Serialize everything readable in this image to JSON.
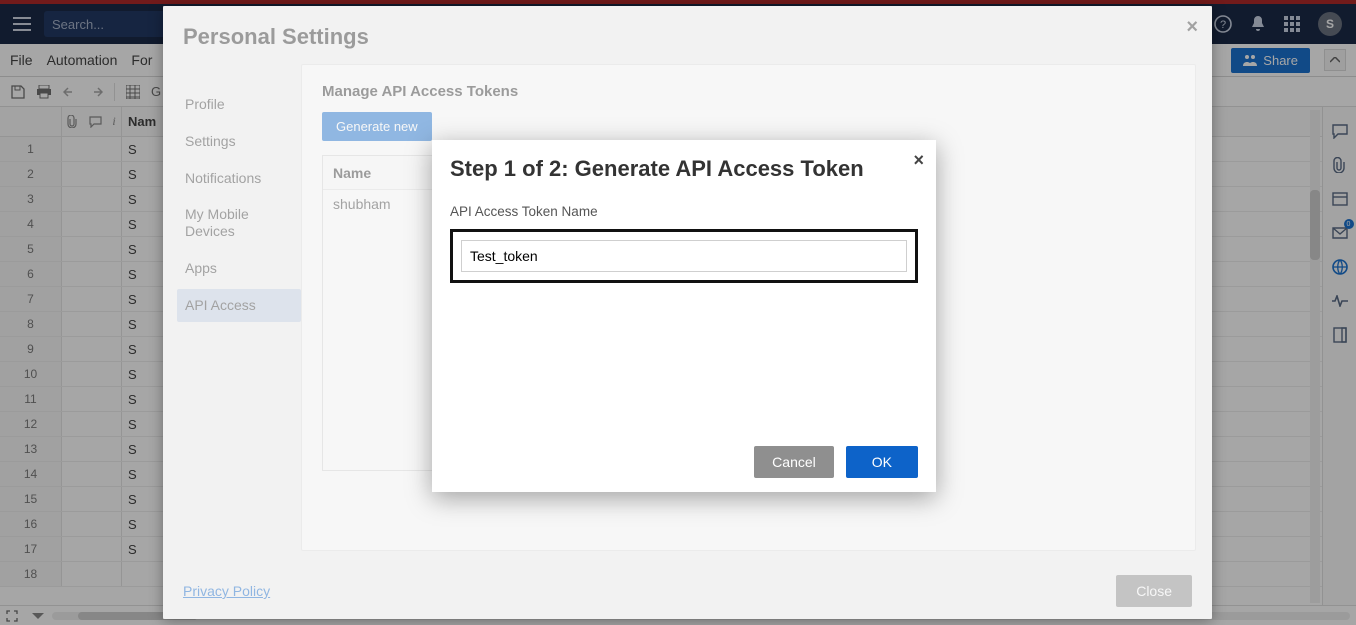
{
  "topbar": {
    "search_placeholder": "Search...",
    "avatar_letter": "S"
  },
  "menubar": {
    "file": "File",
    "automation": "Automation",
    "forms_partial": "For",
    "share": "Share"
  },
  "toolbar": {
    "grid_label_partial": "G"
  },
  "grid": {
    "name_header_partial": "Nam",
    "rows": [
      {
        "num": "1",
        "val": "S"
      },
      {
        "num": "2",
        "val": "S"
      },
      {
        "num": "3",
        "val": "S"
      },
      {
        "num": "4",
        "val": "S"
      },
      {
        "num": "5",
        "val": "S"
      },
      {
        "num": "6",
        "val": "S"
      },
      {
        "num": "7",
        "val": "S"
      },
      {
        "num": "8",
        "val": "S"
      },
      {
        "num": "9",
        "val": "S"
      },
      {
        "num": "10",
        "val": "S"
      },
      {
        "num": "11",
        "val": "S"
      },
      {
        "num": "12",
        "val": "S"
      },
      {
        "num": "13",
        "val": "S"
      },
      {
        "num": "14",
        "val": "S"
      },
      {
        "num": "15",
        "val": "S"
      },
      {
        "num": "16",
        "val": "S"
      },
      {
        "num": "17",
        "val": "S"
      },
      {
        "num": "18",
        "val": ""
      }
    ]
  },
  "settings": {
    "title": "Personal Settings",
    "nav": {
      "profile": "Profile",
      "settings": "Settings",
      "notifications": "Notifications",
      "mobile": "My Mobile Devices",
      "apps": "Apps",
      "api": "API Access"
    },
    "content": {
      "title": "Manage API Access Tokens",
      "generate_btn_partial": "Generate new",
      "table_header": "Name",
      "token_row": "shubham"
    },
    "privacy": "Privacy Policy",
    "close": "Close"
  },
  "step_modal": {
    "title": "Step 1 of 2: Generate API Access Token",
    "field_label": "API Access Token Name",
    "input_value": "Test_token",
    "cancel": "Cancel",
    "ok": "OK"
  }
}
